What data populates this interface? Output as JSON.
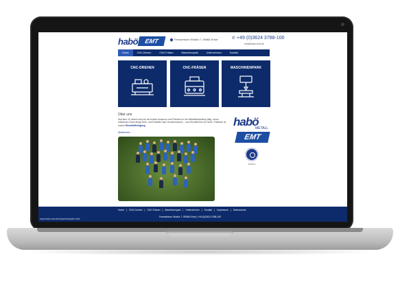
{
  "header": {
    "logo_habo": "habö",
    "logo_emt": "EMT",
    "address": "Fernsehturm Straße 7, 99084 Erfurt",
    "phone": "+49 (0)3624 3788-100",
    "email": "info@habo-emt.de"
  },
  "nav": {
    "items": [
      {
        "label": "Home",
        "active": true
      },
      {
        "label": "CNC-Drehen",
        "active": false
      },
      {
        "label": "CNC-Fräsen",
        "active": false
      },
      {
        "label": "Maschinenpark",
        "active": false
      },
      {
        "label": "Unternehmen",
        "active": false
      },
      {
        "label": "Kontakt",
        "active": false
      }
    ]
  },
  "tiles": [
    {
      "title": "CNC-DREHEN",
      "icon": "lathe-icon"
    },
    {
      "title": "CNC-FRÄSEN",
      "icon": "milling-machine-icon"
    },
    {
      "title": "MASCHINENPARK",
      "icon": "drill-press-icon"
    }
  ],
  "about": {
    "title": "Über uns",
    "text": "Seit über 20 Jahren sind wir mit hohem Anspruch und Präzision in der Metallbearbeitung tätig. Unser erfahrenes Team fertigt Dreh- und Frästeile nach Kundenwunsch – vom Einzelteil bis zur Serie. Präzision ist unsere",
    "highlight": "Einzelteilfertigung",
    "more": "Weiterlesen ›"
  },
  "sidebar": {
    "habo": "habö",
    "metall": "METALL",
    "emt": "EMT",
    "seal_caption": "Zertifiziert"
  },
  "footer": {
    "links": [
      "Home",
      "|",
      "CNC-Drehen",
      "|",
      "CNC-Fräsen",
      "|",
      "Maschinenpark",
      "|",
      "Unternehmen",
      "|",
      "Kontakt",
      "|",
      "Impressum",
      "|",
      "Datenschutz"
    ],
    "contact": "Fernsehturm Straße 7, 99084 Erfurt   |   +49 (0)3624 3788-100"
  },
  "status_url": "www.habo-emt.de/maschinenpark.html",
  "colors": {
    "brand_navy": "#0d2b6b",
    "accent_blue": "#1d4ea3",
    "active_tab": "#2f5bb7"
  }
}
